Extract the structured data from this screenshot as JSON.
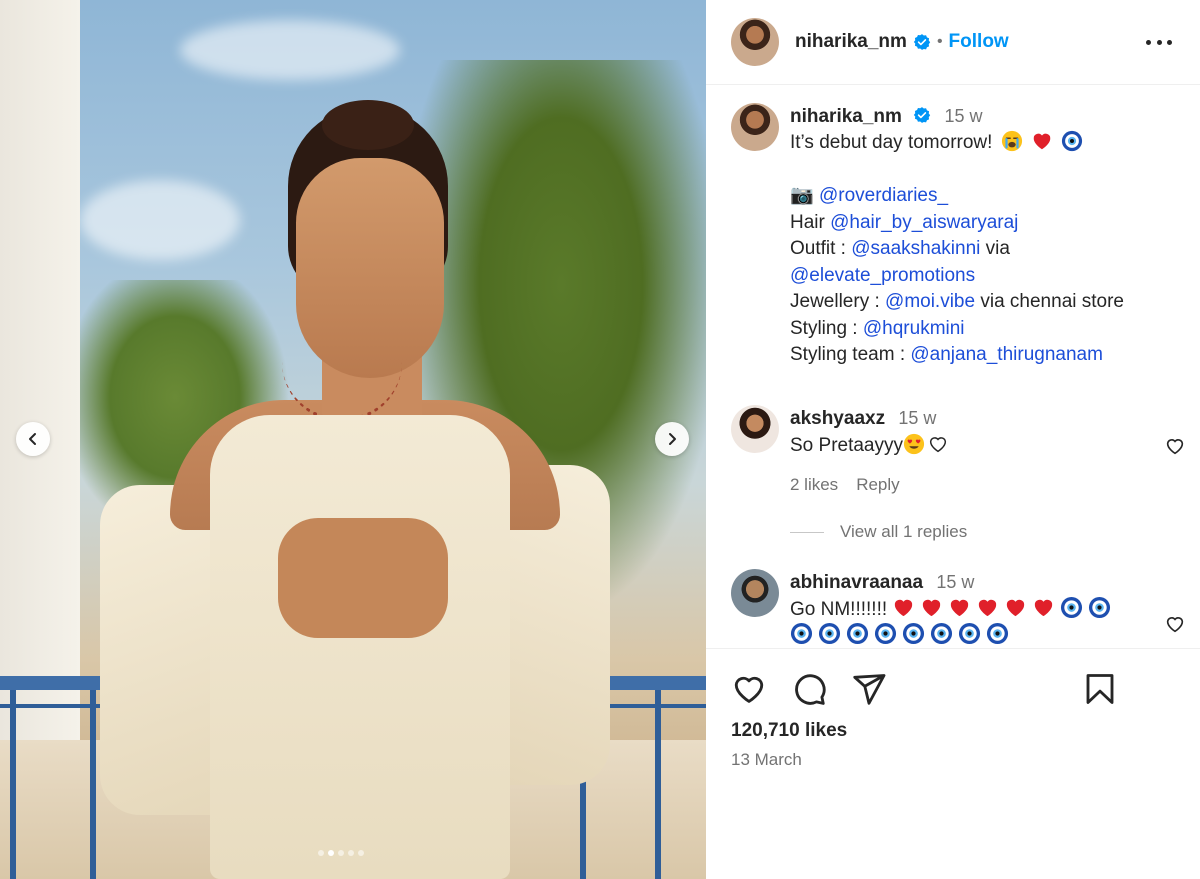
{
  "post": {
    "author": "niharika_nm",
    "follow_label": "Follow",
    "separator": "•",
    "likes": "120,710 likes",
    "date": "13 March",
    "carousel": {
      "total": 5,
      "active_index": 1
    }
  },
  "caption": {
    "author": "niharika_nm",
    "time": "15 w",
    "lines": {
      "intro": "It’s debut day tomorrow!",
      "camera_emoji": "📷",
      "credit_camera": "@roverdiaries_",
      "hair_label": "Hair",
      "hair_mention": "@hair_by_aiswaryaraj",
      "outfit_label": "Outfit :",
      "outfit_mention": "@saakshakinni",
      "via": "via",
      "outfit_mention2": "@elevate_promotions",
      "jewellery_label": "Jewellery :",
      "jewellery_mention": "@moi.vibe",
      "jewellery_suffix": "via chennai store",
      "styling_label": "Styling :",
      "styling_mention": "@hqrukmini",
      "team_label": "Styling team :",
      "team_mention": "@anjana_thirugnanam"
    }
  },
  "comments": [
    {
      "author": "akshyaaxz",
      "time": "15 w",
      "text": "So Pretaayyy",
      "likes": "2 likes",
      "reply_label": "Reply",
      "view_replies": "View all 1 replies"
    },
    {
      "author": "abhinavraanaa",
      "time": "15 w",
      "text": "Go NM!!!!!!!"
    }
  ],
  "icons": {
    "heart": "heart-icon",
    "comment": "comment-icon",
    "share": "share-icon",
    "bookmark": "bookmark-icon",
    "more": "more-icon",
    "verified": "verified-badge-icon"
  },
  "colors": {
    "link": "#0095f6",
    "mention": "#1d4ed8",
    "muted": "#737373",
    "text": "#262626"
  }
}
